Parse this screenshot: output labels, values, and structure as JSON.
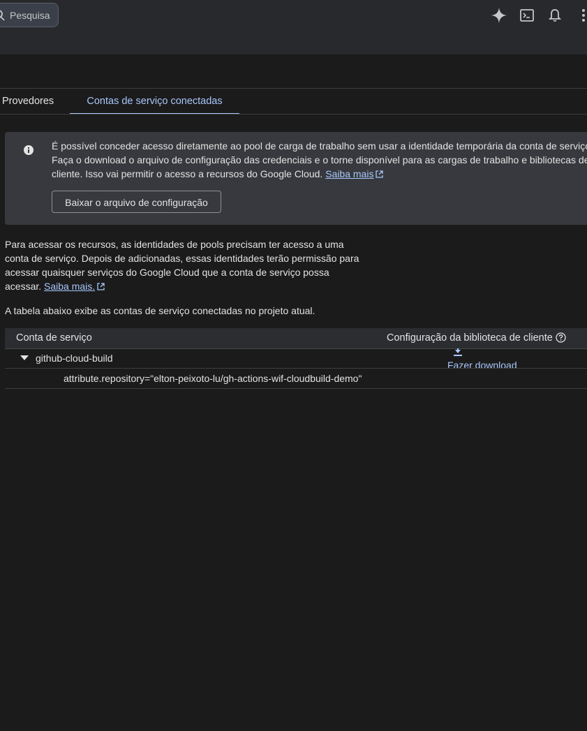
{
  "header": {
    "search_placeholder": "Pesquisa",
    "icons": [
      "gemini-sparkle-icon",
      "cloud-shell-icon",
      "notifications-bell-icon",
      "more-vert-icon"
    ]
  },
  "tabs": [
    {
      "label": "Provedores",
      "active": false
    },
    {
      "label": "Contas de serviço conectadas",
      "active": true
    }
  ],
  "info_box": {
    "line1": "É possível conceder acesso diretamente ao pool de carga de trabalho sem usar a identidade temporária da conta de serviço.",
    "line2": "Faça o download o arquivo de configuração das credenciais e o torne disponível para as cargas de trabalho e bibliotecas de",
    "line3": "cliente. Isso vai permitir o acesso a recursos do Google Cloud.",
    "link": "Saiba mais",
    "button": "Baixar o arquivo de configuração"
  },
  "description": {
    "line1": "Para acessar os recursos, as identidades de pools precisam ter acesso a uma",
    "line2": "conta de serviço. Depois de adicionadas, essas identidades terão permissão para",
    "line3": "acessar quaisquer serviços do Google Cloud que a conta de serviço possa",
    "line4": "acessar.",
    "link": "Saiba mais."
  },
  "table_note": "A tabela abaixo exibe as contas de serviço conectadas no projeto atual.",
  "table": {
    "columns": [
      "Conta de serviço",
      "Configuração da biblioteca de cliente"
    ],
    "rows": [
      {
        "account": "github-cloud-build",
        "expanded": true,
        "action": "Fazer download"
      },
      {
        "attribute": "attribute.repository=\"elton-peixoto-lu/gh-actions-wif-cloudbuild-demo\""
      }
    ]
  },
  "colors": {
    "background": "#1b1b1c",
    "topbar": "#27292d",
    "accent": "#a8c7fa",
    "info_box": "#37393e",
    "text": "#e3e3e3"
  }
}
